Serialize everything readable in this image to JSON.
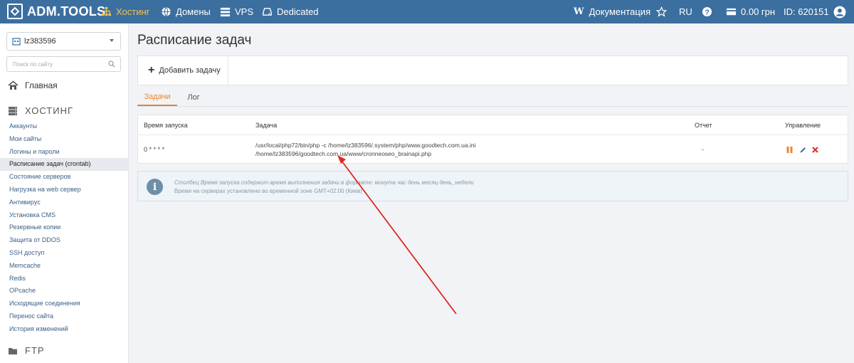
{
  "topbar": {
    "logo_text": "ADM.TOOLS",
    "nav": {
      "hosting": "Хостинг",
      "domains": "Домены",
      "vps": "VPS",
      "dedicated": "Dedicated",
      "docs": "Документация",
      "lang": "RU",
      "balance": "0.00 грн",
      "user_id": "ID: 620151"
    },
    "colors": {
      "bar": "#3b6fa0",
      "active": "#f5c34b"
    }
  },
  "sidebar": {
    "account": "lz383596",
    "search_placeholder": "Поиск по сайту",
    "home": "Главная",
    "section_hosting": "ХОСТИНГ",
    "items": [
      "Аккаунты",
      "Мои сайты",
      "Логины и пароли",
      "Расписание задач (crontab)",
      "Состояние серверов",
      "Нагрузка на web сервер",
      "Антивирус",
      "Установка CMS",
      "Резервные копии",
      "Защита от DDOS",
      "SSH доступ",
      "Memcache",
      "Redis",
      "OPcache",
      "Исходящие соединения",
      "Перенос сайта",
      "История изменений"
    ],
    "active_index": 3,
    "section_ftp": "FTP"
  },
  "main": {
    "title": "Расписание задач",
    "add_task": "Добавить задачу",
    "tabs": {
      "tasks": "Задачи",
      "log": "Лог"
    },
    "table": {
      "headers": {
        "time": "Время запуска",
        "task": "Задача",
        "report": "Отчет",
        "control": "Управление"
      },
      "rows": [
        {
          "time": "0 * * * *",
          "task": "/usr/local/php72/bin/php -c /home/lz383596/.system/php/www.goodtech.com.ua.ini /home/lz383596/goodtech.com.ua/www/cronneoseo_brainapi.php",
          "report": "-"
        }
      ]
    },
    "info": {
      "line1": "Столбец Время запуска содержит время выполнения задачи в формате: минута час день месяц день_недели",
      "line2": "Время на серверах установлено во временной зоне GMT+02:00 (Киев)"
    }
  }
}
